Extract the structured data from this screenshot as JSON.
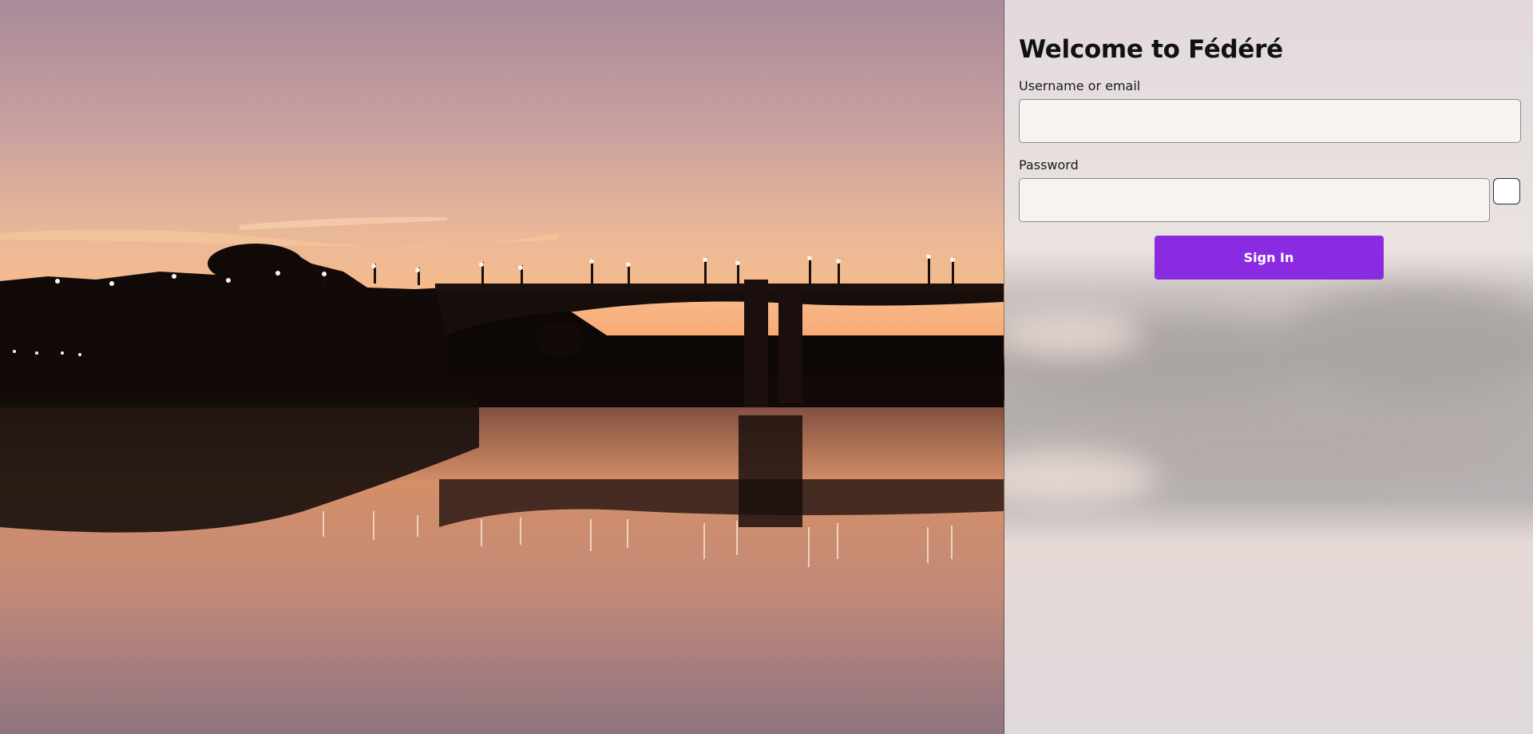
{
  "login": {
    "title": "Welcome to Fédéré",
    "username_label": "Username or email",
    "username_value": "",
    "password_label": "Password",
    "password_value": "",
    "submit_label": "Sign In"
  },
  "colors": {
    "accent": "#8a2be2",
    "panel_bg": "#e6dcdc"
  },
  "icons": {
    "reveal_password": "eye-icon"
  }
}
